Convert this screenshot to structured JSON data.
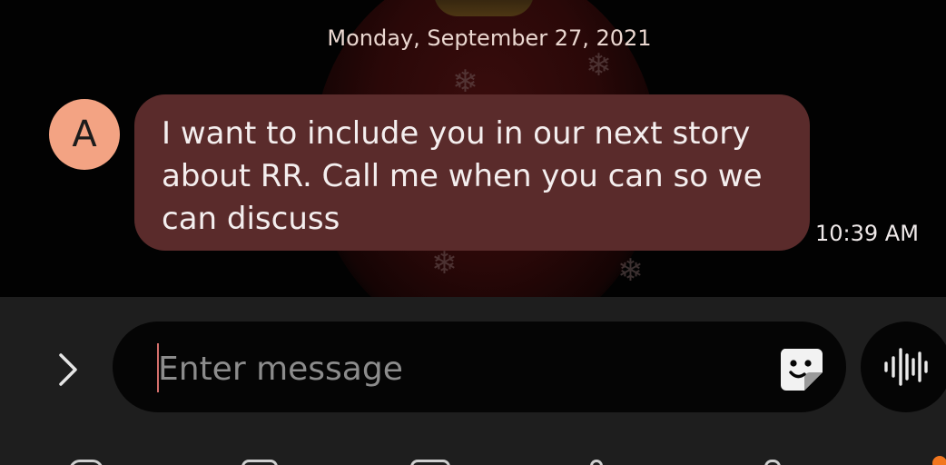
{
  "conversation": {
    "date_header": "Monday, September 27, 2021",
    "messages": [
      {
        "sender_initial": "A",
        "text": "I want to include you in our next story about RR. Call me when you can so we can discuss",
        "time": "10:39 AM",
        "avatar_color": "#f3a383",
        "bubble_color": "#5a2b2b"
      }
    ]
  },
  "composer": {
    "placeholder": "Enter message",
    "value": "",
    "expand_icon": "chevron-right-icon",
    "sticker_icon": "sticker-icon",
    "voice_icon": "voice-waveform-icon",
    "cursor_color": "#d5706c"
  },
  "bottom_toolbar": {
    "notification_color": "#f2771f"
  }
}
